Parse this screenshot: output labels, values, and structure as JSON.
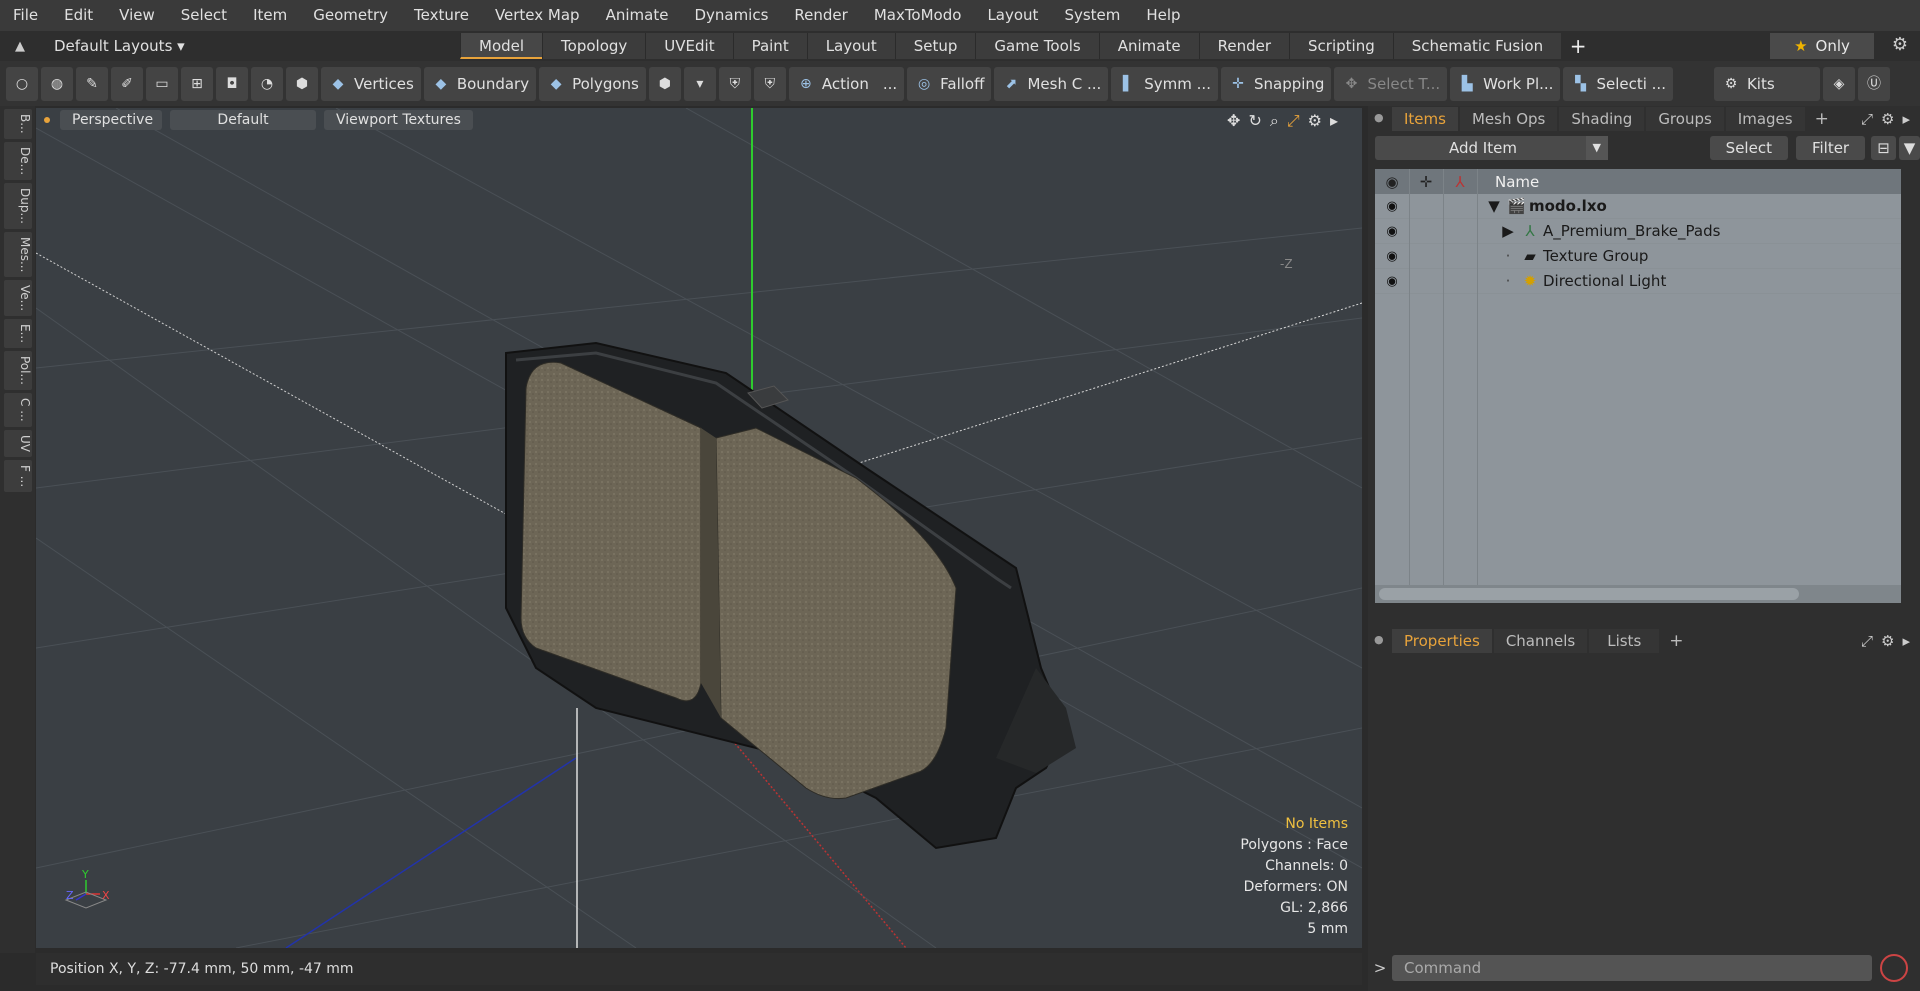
{
  "menu": [
    "File",
    "Edit",
    "View",
    "Select",
    "Item",
    "Geometry",
    "Texture",
    "Vertex Map",
    "Animate",
    "Dynamics",
    "Render",
    "MaxToModo",
    "Layout",
    "System",
    "Help"
  ],
  "layout_label": "Default Layouts ▾",
  "tabs": [
    "Model",
    "Topology",
    "UVEdit",
    "Paint",
    "Layout",
    "Setup",
    "Game Tools",
    "Animate",
    "Render",
    "Scripting",
    "Schematic Fusion"
  ],
  "active_tab": "Model",
  "only_label": "Only",
  "toolbar": {
    "vertices": "Vertices",
    "boundary": "Boundary",
    "polygons": "Polygons",
    "action": "Action",
    "ellipsis": "...",
    "falloff": "Falloff",
    "mesh": "Mesh C ...",
    "symm": "Symm ...",
    "snapping": "Snapping",
    "select_t": "Select T...",
    "work_pl": "Work Pl...",
    "selecti": "Selecti ...",
    "kits": "Kits"
  },
  "left_tabs": [
    "B...",
    "De...",
    "Dup...",
    "Mes...",
    "Ve...",
    "E...",
    "Pol...",
    "C ...",
    "UV",
    "F ..."
  ],
  "viewport": {
    "perspective": "Perspective",
    "default": "Default",
    "textures": "Viewport Textures",
    "axis_z_label": "-Z",
    "info": {
      "no_items": "No Items",
      "polygons": "Polygons : Face",
      "channels": "Channels: 0",
      "deformers": "Deformers: ON",
      "gl": "GL: 2,866",
      "scale": "5 mm"
    },
    "gizmo": {
      "y": "Y",
      "z": "Z",
      "x": "X"
    }
  },
  "status": "Position X, Y, Z:   -77.4 mm, 50 mm, -47 mm",
  "items_panel": {
    "tabs": [
      "Items",
      "Mesh Ops",
      "Shading",
      "Groups",
      "Images"
    ],
    "add_item": "Add Item",
    "select": "Select",
    "filter": "Filter",
    "name_header": "Name",
    "rows": [
      {
        "label": "modo.lxo",
        "icon": "scene-icon"
      },
      {
        "label": "A_Premium_Brake_Pads",
        "icon": "mesh-icon"
      },
      {
        "label": "Texture Group",
        "icon": "texture-group-icon"
      },
      {
        "label": "Directional Light",
        "icon": "light-icon"
      }
    ]
  },
  "props_panel": {
    "tabs": [
      "Properties",
      "Channels",
      "Lists"
    ],
    "command_placeholder": "Command"
  }
}
